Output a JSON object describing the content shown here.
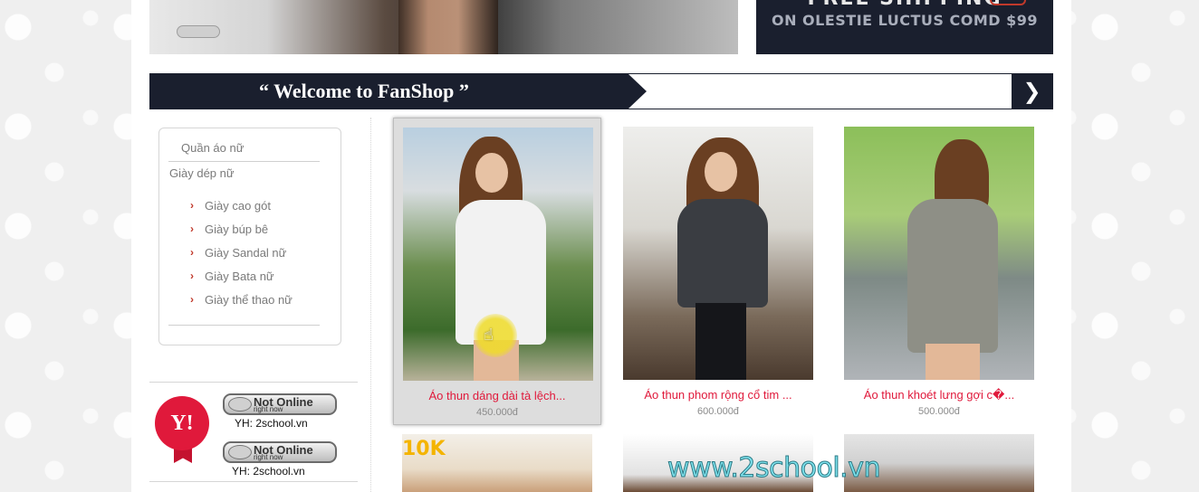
{
  "banner": {
    "promo_top": "FREE SHIPPING",
    "promo_sub": "ON OLESTIE LUCTUS COMD $99"
  },
  "welcome": {
    "title": "“ Welcome to FanShop ”",
    "next_icon": "chevron-right-icon",
    "next_glyph": "❯"
  },
  "sidebar": {
    "categories": [
      "Quần áo nữ",
      "Giày dép nữ"
    ],
    "subcategories": [
      "Giày cao gót",
      "Giày búp bê",
      "Giày Sandal nữ",
      "Giày Bata nữ",
      "Giày thể thao nữ"
    ],
    "chevron_glyph": "›"
  },
  "support": {
    "badge_text": "Y!",
    "contacts": [
      {
        "status": "Not Online",
        "status_sub": "right now",
        "label": "YH: 2school.vn"
      },
      {
        "status": "Not Online",
        "status_sub": "right now",
        "label": "YH: 2school.vn"
      }
    ]
  },
  "products": [
    {
      "name": "Áo thun dáng dài tà lệch...",
      "price": "450.000đ"
    },
    {
      "name": "Áo thun phom rộng cổ tim ...",
      "price": "600.000đ"
    },
    {
      "name": "Áo thun khoét lưng gợi c�...",
      "price": "500.000đ"
    }
  ],
  "bottom_thumbs": {
    "tag": "10K"
  },
  "watermark": "www.2school.vn",
  "colors": {
    "nav_dark": "#1a1f2e",
    "price_red": "#e0193b",
    "accent_red": "#c0392b"
  }
}
